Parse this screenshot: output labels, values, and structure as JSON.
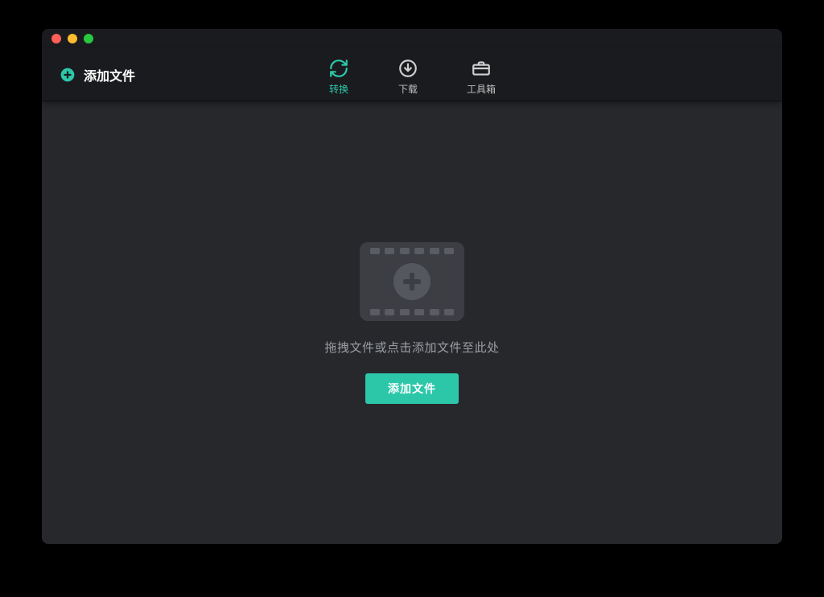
{
  "colors": {
    "accent": "#2cc7a9",
    "window_bg": "#27282c",
    "toolbar_bg": "#1a1b1e"
  },
  "toolbar": {
    "add_file_label": "添加文件"
  },
  "tabs": {
    "convert": {
      "label": "转换",
      "active": true
    },
    "download": {
      "label": "下载",
      "active": false
    },
    "toolbox": {
      "label": "工具箱",
      "active": false
    }
  },
  "dropzone": {
    "hint": "拖拽文件或点击添加文件至此处",
    "button_label": "添加文件",
    "icon": "filmstrip-plus-icon"
  }
}
